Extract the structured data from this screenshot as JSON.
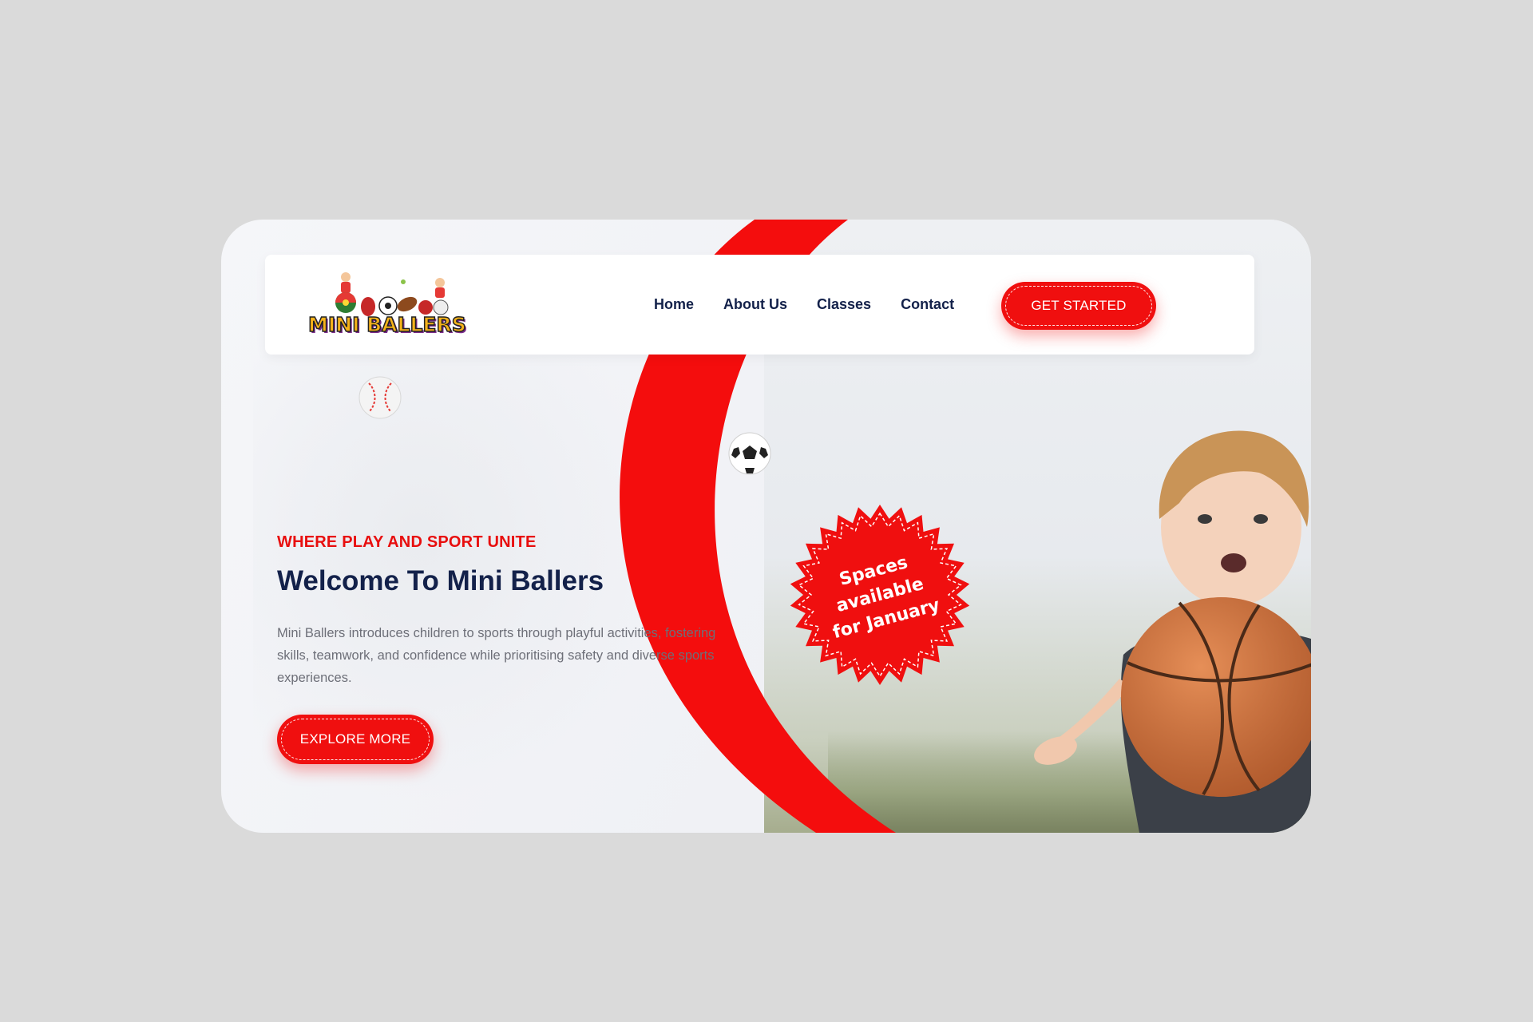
{
  "header": {
    "logo_text": "MINI BALLERS",
    "nav": [
      {
        "label": "Home"
      },
      {
        "label": "About Us"
      },
      {
        "label": "Classes"
      },
      {
        "label": "Contact"
      }
    ],
    "cta_label": "GET STARTED"
  },
  "hero": {
    "eyebrow": "WHERE PLAY AND SPORT UNITE",
    "title": "Welcome To Mini Ballers",
    "description": "Mini Ballers introduces children to sports through playful activities, fostering skills, teamwork, and confidence while prioritising safety and diverse sports experiences.",
    "button_label": "EXPLORE MORE"
  },
  "badge": {
    "line1": "Spaces",
    "line2": "available",
    "line3": "for January"
  },
  "colors": {
    "brand_red": "#f00f0f",
    "navy": "#13214a",
    "page_bg": "#dadada",
    "logo_yellow": "#f6b21a"
  },
  "icons": {
    "baseball": "baseball-icon",
    "football": "soccer-ball-icon",
    "basketball": "basketball-icon"
  }
}
